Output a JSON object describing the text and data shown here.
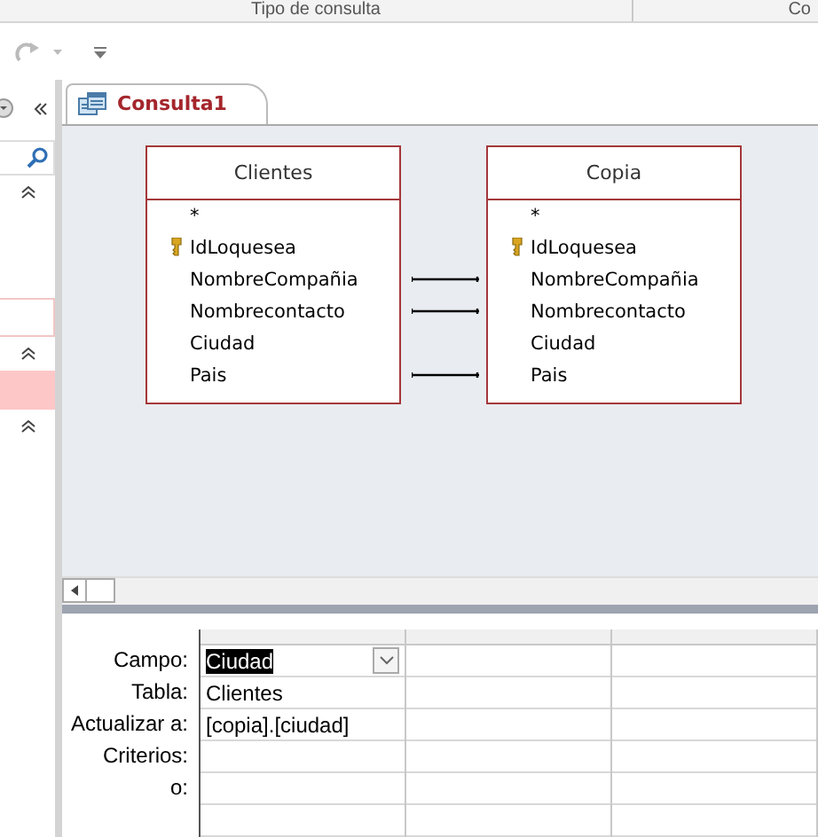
{
  "ribbon": {
    "group_label": "Tipo de consulta",
    "next_group_label": "Co"
  },
  "document_tab": {
    "title": "Consulta1",
    "selected": true
  },
  "tables": [
    {
      "name": "Clientes",
      "fields": [
        {
          "name": "*",
          "key": false,
          "joined": false
        },
        {
          "name": "IdLoquesea",
          "key": true,
          "joined": false
        },
        {
          "name": "NombreCompañia",
          "key": false,
          "joined": true
        },
        {
          "name": "Nombrecontacto",
          "key": false,
          "joined": true
        },
        {
          "name": "Ciudad",
          "key": false,
          "joined": false
        },
        {
          "name": "Pais",
          "key": false,
          "joined": true
        }
      ]
    },
    {
      "name": "Copia",
      "fields": [
        {
          "name": "*",
          "key": false
        },
        {
          "name": "IdLoquesea",
          "key": true
        },
        {
          "name": "NombreCompañia",
          "key": false
        },
        {
          "name": "Nombrecontacto",
          "key": false
        },
        {
          "name": "Ciudad",
          "key": false
        },
        {
          "name": "Pais",
          "key": false
        }
      ]
    }
  ],
  "grid": {
    "row_labels": [
      "Campo:",
      "Tabla:",
      "Actualizar a:",
      "Criterios:",
      "o:"
    ],
    "columns": [
      {
        "field": "Ciudad",
        "field_selected": true,
        "table": "Clientes",
        "update_to": "[copia].[ciudad]"
      }
    ]
  }
}
